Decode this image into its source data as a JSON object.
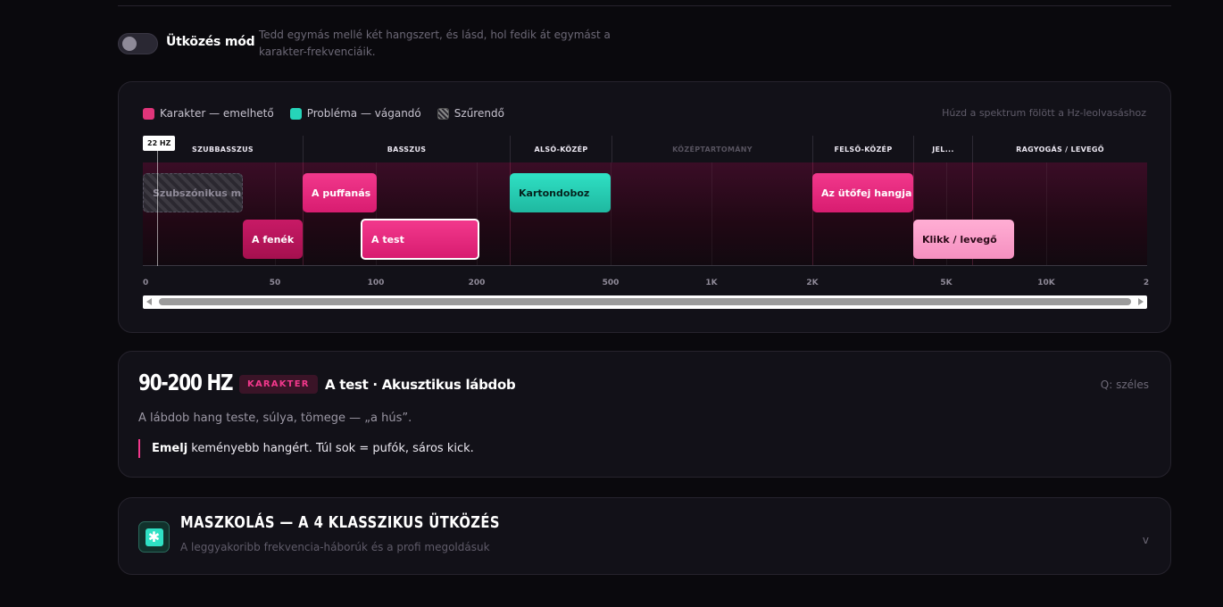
{
  "collision": {
    "label": "Ütközés mód",
    "description": "Tedd egymás mellé két hangszert, és lásd, hol fedik át egymást a karakter-frekvenciáik.",
    "enabled": false
  },
  "legend": {
    "character": "Karakter — emelhető",
    "problem": "Probléma — vágandó",
    "filter": "Szűrendő"
  },
  "hint": "Húzd a spektrum fölött a Hz-leolvasáshoz",
  "cursor_hz": "22 HZ",
  "regions": [
    {
      "label": "SZUBBASSZUS",
      "dim": false
    },
    {
      "label": "BASSZUS",
      "dim": false
    },
    {
      "label": "ALSÓ-KÖZÉP",
      "dim": false
    },
    {
      "label": "KÖZÉPTARTOMÁNY",
      "dim": true
    },
    {
      "label": "FELSŐ-KÖZÉP",
      "dim": false
    },
    {
      "label": "JEL...",
      "dim": false
    },
    {
      "label": "RAGYOGÁS / LEVEGŐ",
      "dim": false
    }
  ],
  "bands": [
    {
      "label": "Szubszónikus m...",
      "kind": "filter",
      "lo": 20,
      "hi": 40
    },
    {
      "label": "A fenék",
      "kind": "character",
      "lo": 40,
      "hi": 60
    },
    {
      "label": "A puffanás",
      "kind": "character",
      "lo": 60,
      "hi": 100
    },
    {
      "label": "A test",
      "kind": "character",
      "lo": 90,
      "hi": 200,
      "selected": true
    },
    {
      "label": "Kartondoboz",
      "kind": "problem",
      "lo": 250,
      "hi": 500
    },
    {
      "label": "Az ütőfej hangja",
      "kind": "character",
      "lo": 2000,
      "hi": 4000
    },
    {
      "label": "Klikk / levegő",
      "kind": "character",
      "lo": 4000,
      "hi": 8000
    }
  ],
  "ticks": [
    "0",
    "50",
    "100",
    "200",
    "500",
    "1K",
    "2K",
    "5K",
    "10K",
    "2"
  ],
  "detail": {
    "range": "90-200 HZ",
    "type": "KARAKTER",
    "title": "A test · Akusztikus lábdob",
    "q": "Q: széles",
    "description": "A lábdob hang teste, súlya, tömege — „a hús”.",
    "advice_bold": "Emelj",
    "advice_rest": " keményebb hangért. Túl sok = pufók, sáros kick."
  },
  "masking": {
    "title": "MASZKOLÁS — A 4 KLASSZIKUS ÜTKÖZÉS",
    "subtitle": "A leggyakoribb frekvencia-háborúk és a profi megoldásuk",
    "chevron": "v",
    "icon": "asterisk-icon"
  },
  "colors": {
    "character": "#f2388c",
    "problem": "#26d4b9",
    "background": "#0a090d",
    "card": "#121118"
  }
}
